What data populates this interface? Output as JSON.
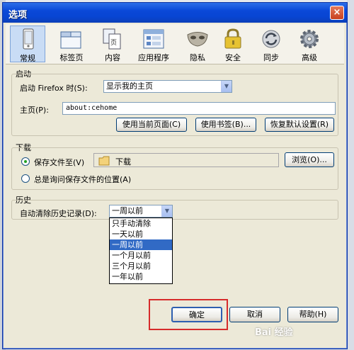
{
  "window": {
    "title": "选项",
    "close_glyph": "×"
  },
  "toolbar": {
    "items": [
      {
        "label": "常规",
        "icon": "phone-icon"
      },
      {
        "label": "标签页",
        "icon": "tabs-icon"
      },
      {
        "label": "内容",
        "icon": "content-icon"
      },
      {
        "label": "应用程序",
        "icon": "applications-icon"
      },
      {
        "label": "隐私",
        "icon": "mask-icon"
      },
      {
        "label": "安全",
        "icon": "lock-icon"
      },
      {
        "label": "同步",
        "icon": "sync-icon"
      },
      {
        "label": "高级",
        "icon": "gear-icon"
      }
    ],
    "selected": "常规"
  },
  "startup": {
    "group_label": "启动",
    "when_label": "启动 Firefox 时(S):",
    "when_value": "显示我的主页",
    "home_label": "主页(P):",
    "home_value": "about:cehome",
    "use_current": "使用当前页面(C)",
    "use_bookmark": "使用书签(B)...",
    "restore_default": "恢复默认设置(R)"
  },
  "downloads": {
    "group_label": "下载",
    "save_to_label": "保存文件至(V)",
    "folder": "下载",
    "browse": "浏览(O)...",
    "always_ask": "总是询问保存文件的位置(A)"
  },
  "history": {
    "group_label": "历史",
    "clear_label": "自动清除历史记录(D):",
    "selected_value": "一周以前",
    "options": [
      "只手动清除",
      "一天以前",
      "一周以前",
      "一个月以前",
      "三个月以前",
      "一年以前"
    ]
  },
  "footer": {
    "ok": "确定",
    "cancel": "取消",
    "help": "帮助(H)"
  },
  "watermark": "Bai 经验",
  "colors": {
    "title_bar": "#0a48d8",
    "highlight": "#316ac5",
    "annotation_box": "#d62b2b"
  }
}
